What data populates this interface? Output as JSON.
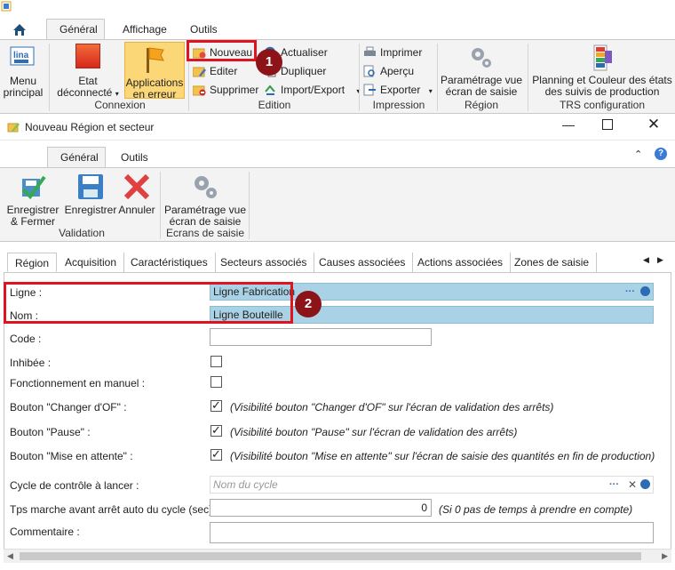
{
  "app": {
    "tabs": [
      "Général",
      "Affichage",
      "Outils"
    ],
    "groups": {
      "connexion": "Connexion",
      "edition": "Edition",
      "impression": "Impression",
      "region": "Région",
      "trs": "TRS configuration"
    },
    "buttons": {
      "menu": "Menu principal",
      "menu_line1": "Menu",
      "menu_line2": "principal",
      "etat_line1": "Etat",
      "etat_line2": "déconnecté",
      "app_line1": "Applications",
      "app_line2": "en erreur",
      "nouveau": "Nouveau",
      "editer": "Editer",
      "supprimer": "Supprimer",
      "actualiser": "Actualiser",
      "dupliquer": "Dupliquer",
      "import_export": "Import/Export",
      "imprimer": "Imprimer",
      "apercu": "Aperçu",
      "exporter": "Exporter",
      "param_line1": "Paramétrage vue",
      "param_line2": "écran de saisie",
      "planning_line1": "Planning et Couleur des états",
      "planning_line2": "des suivis de production"
    },
    "lina_logo": "lina"
  },
  "window": {
    "title": "Nouveau Région et secteur",
    "tabs": [
      "Général",
      "Outils"
    ],
    "groups": {
      "validation": "Validation",
      "ecrans": "Ecrans de saisie"
    },
    "buttons": {
      "save_close_line1": "Enregistrer",
      "save_close_line2": "& Fermer",
      "save": "Enregistrer",
      "cancel": "Annuler",
      "param_line1": "Paramétrage vue",
      "param_line2": "écran de saisie"
    }
  },
  "subtabs": [
    "Région",
    "Acquisition",
    "Caractéristiques",
    "Secteurs associés",
    "Causes associées",
    "Actions associées",
    "Zones de saisie"
  ],
  "form": {
    "ligne_label": "Ligne :",
    "ligne_value": "Ligne Fabrication",
    "nom_label": "Nom :",
    "nom_value": "Ligne Bouteille",
    "code_label": "Code :",
    "code_value": "",
    "inhibee_label": "Inhibée :",
    "manuel_label": "Fonctionnement en manuel :",
    "changer_label": "Bouton \"Changer d'OF\" :",
    "changer_hint": "(Visibilité bouton \"Changer d'OF\" sur l'écran de validation des arrêts)",
    "pause_label": "Bouton \"Pause\" :",
    "pause_hint": "(Visibilité bouton \"Pause\" sur l'écran de validation des arrêts)",
    "attente_label": "Bouton \"Mise en attente\" :",
    "attente_hint": "(Visibilité bouton \"Mise en attente\" sur l'écran de saisie des quantités en fin de production)",
    "cycle_label": "Cycle de contrôle à lancer :",
    "cycle_placeholder": "Nom du cycle",
    "tps_label": "Tps marche avant arrêt auto du cycle (sec) :",
    "tps_value": "0",
    "tps_hint": "(Si 0 pas de temps à prendre en compte)",
    "commentaire_label": "Commentaire :",
    "commentaire_value": ""
  },
  "badges": [
    "1",
    "2"
  ],
  "colors": {
    "highlight_red": "#e0141e",
    "badge": "#8c1419",
    "field_blue": "#a9d2e6"
  }
}
